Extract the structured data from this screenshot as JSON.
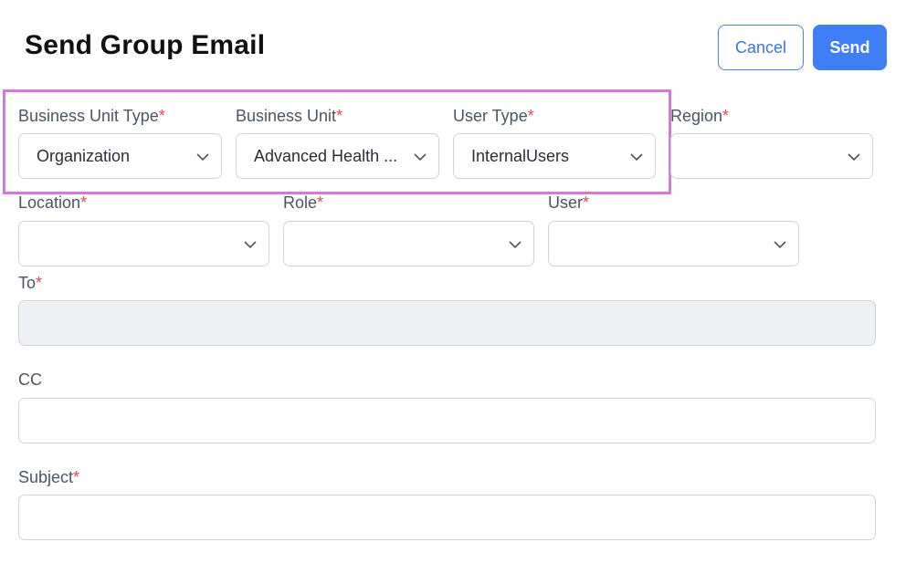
{
  "page": {
    "title": "Send Group Email"
  },
  "actions": {
    "cancel_label": "Cancel",
    "send_label": "Send"
  },
  "required_marker": "*",
  "fields": {
    "business_unit_type": {
      "label": "Business Unit Type",
      "value": "Organization"
    },
    "business_unit": {
      "label": "Business Unit",
      "value": "Advanced Health ..."
    },
    "user_type": {
      "label": "User Type",
      "value": "InternalUsers"
    },
    "region": {
      "label": "Region",
      "value": ""
    },
    "location": {
      "label": "Location",
      "value": ""
    },
    "role": {
      "label": "Role",
      "value": ""
    },
    "user": {
      "label": "User",
      "value": ""
    },
    "to": {
      "label": "To",
      "value": ""
    },
    "cc": {
      "label": "CC",
      "value": ""
    },
    "subject": {
      "label": "Subject",
      "value": ""
    }
  },
  "colors": {
    "primary": "#3f7ef5",
    "required": "#e5484d",
    "highlight": "#d17ad8"
  }
}
